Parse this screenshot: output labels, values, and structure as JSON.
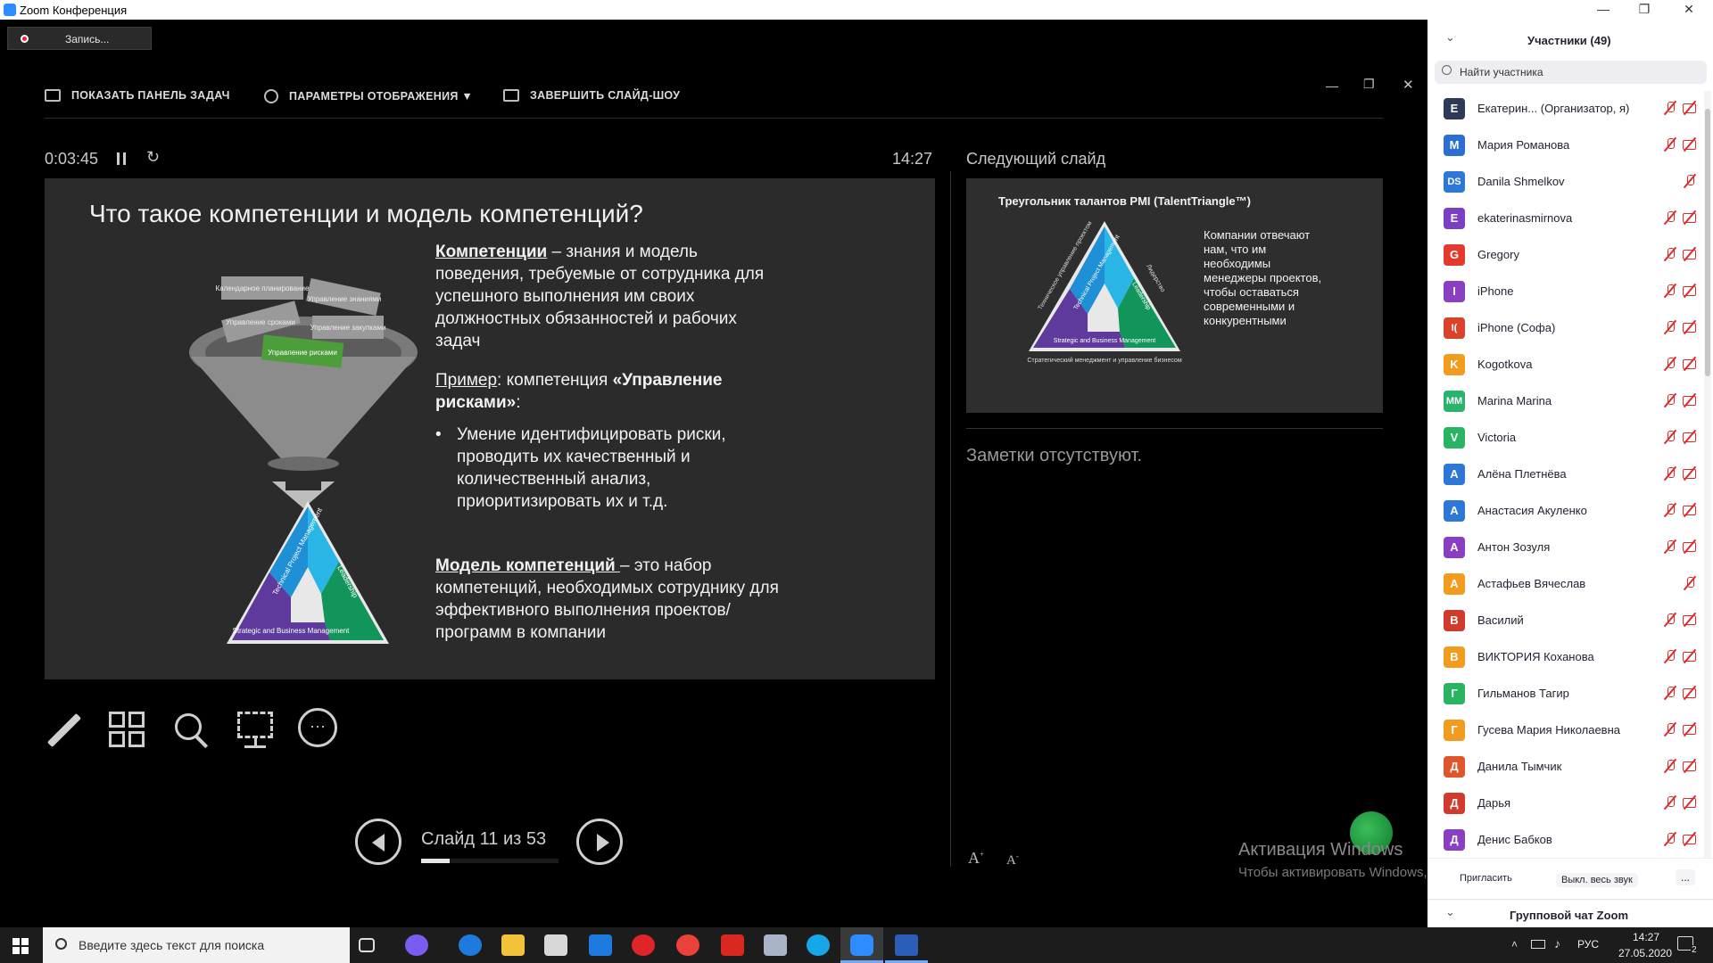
{
  "window": {
    "title": "Zoom Конференция"
  },
  "recording": {
    "label": "Запись..."
  },
  "toolbar": {
    "show_taskbar": "ПОКАЗАТЬ ПАНЕЛЬ ЗАДАЧ",
    "display_settings": "ПАРАМЕТРЫ ОТОБРАЖЕНИЯ ▼",
    "end_show": "ЗАВЕРШИТЬ СЛАЙД-ШОУ"
  },
  "timer": {
    "elapsed": "0:03:45",
    "clock": "14:27"
  },
  "next_slide_label": "Следующий слайд",
  "current_slide": {
    "title": "Что такое компетенции и модель компетенций?",
    "funnel_labels": [
      "Календарное планирование",
      "Управление знаниями",
      "Управление сроками",
      "Управление закупками",
      "Управление рисками"
    ],
    "triangle": {
      "left": "Technical Project Management",
      "right": "Leadership",
      "bottom": "Strategic and Business Management"
    },
    "p1_term": "Компетенции",
    "p1_text": " – знания и модель поведения, требуемые от сотрудника для успешного выполнения им своих должностных обязанностей и рабочих задач",
    "p2_term": "Пример",
    "p2_text": ": компетенция ",
    "p2_bold": "«Управление рисками»",
    "p2_end": ":",
    "bullet": "Умение идентифицировать риски, проводить их качественный и количественный анализ, приоритизировать их и т.д.",
    "p3_term": "Модель компетенций ",
    "p3_text": " – это набор компетенций, необходимых сотруднику для эффективного выполнения проектов/программ в компании"
  },
  "next_slide": {
    "title": "Треугольник талантов PMI (TalentTriangle™)",
    "body": "Компании отвечают нам, что им необходимы менеджеры проектов, чтобы оставаться современными и конкурентными",
    "tri_left_ru": "Техническое управление проектом",
    "tri_right_ru": "Лидерство",
    "tri_bottom_ru": "Стратегический менеджмент и управление бизнесом",
    "tri_left_en": "Technical Project Management",
    "tri_right_en": "Leadership",
    "tri_bottom_en": "Strategic and Business Management"
  },
  "notes": "Заметки отсутствуют.",
  "navigation": {
    "slide_counter": "Слайд 11 из 53",
    "progress": 0.21
  },
  "watermark": {
    "line1": "Активация Windows",
    "line2": "Чтобы активировать Windows, перейдите в раздел \"Параметры\"."
  },
  "participants_panel": {
    "header": "Участники (49)",
    "search_placeholder": "Найти участника",
    "rows": [
      {
        "initials": "E",
        "color": "#2d3a55",
        "name": "Екатерин...  (Организатор, я)"
      },
      {
        "initials": "M",
        "color": "#2d6fd0",
        "name": "Мария Романова"
      },
      {
        "initials": "DS",
        "color": "#2d78d6",
        "name": "Danila Shmelkov"
      },
      {
        "initials": "E",
        "color": "#7b3fc4",
        "name": "ekaterinasmirnova"
      },
      {
        "initials": "G",
        "color": "#e23b2e",
        "name": "Gregory"
      },
      {
        "initials": "I",
        "color": "#8a3fc2",
        "name": "iPhone"
      },
      {
        "initials": "I(",
        "color": "#d9432a",
        "name": "iPhone (Софа)"
      },
      {
        "initials": "K",
        "color": "#f29c1f",
        "name": "Kogotkova"
      },
      {
        "initials": "MM",
        "color": "#2ab46b",
        "name": "Marina Marina"
      },
      {
        "initials": "V",
        "color": "#28b463",
        "name": "Victoria"
      },
      {
        "initials": "А",
        "color": "#2d78d6",
        "name": "Алёна Плетнёва"
      },
      {
        "initials": "А",
        "color": "#2d78d6",
        "name": "Анастасия Акуленко"
      },
      {
        "initials": "А",
        "color": "#8a3fc2",
        "name": "Антон Зозуля"
      },
      {
        "initials": "А",
        "color": "#f29c1f",
        "name": "Астафьев Вячеслав"
      },
      {
        "initials": "В",
        "color": "#d13b2e",
        "name": "Василий"
      },
      {
        "initials": "В",
        "color": "#f29c1f",
        "name": "ВИКТОРИЯ Коханова"
      },
      {
        "initials": "Г",
        "color": "#28b463",
        "name": "Гильманов Тагир"
      },
      {
        "initials": "Г",
        "color": "#f29c1f",
        "name": "Гусева Мария Николаевна"
      },
      {
        "initials": "Д",
        "color": "#e0552a",
        "name": "Данила Тымчик"
      },
      {
        "initials": "Д",
        "color": "#d13b2e",
        "name": "Дарья"
      },
      {
        "initials": "Д",
        "color": "#8a3fc2",
        "name": "Денис Бабков"
      }
    ],
    "invite": "Пригласить",
    "mute_all": "Выкл. весь звук",
    "more": "...",
    "group_chat": "Групповой чат Zoom"
  },
  "taskbar": {
    "search_placeholder": "Введите здесь текст для поиска",
    "lang": "РУС",
    "time": "14:27",
    "date": "27.05.2020",
    "notifications": "2"
  }
}
